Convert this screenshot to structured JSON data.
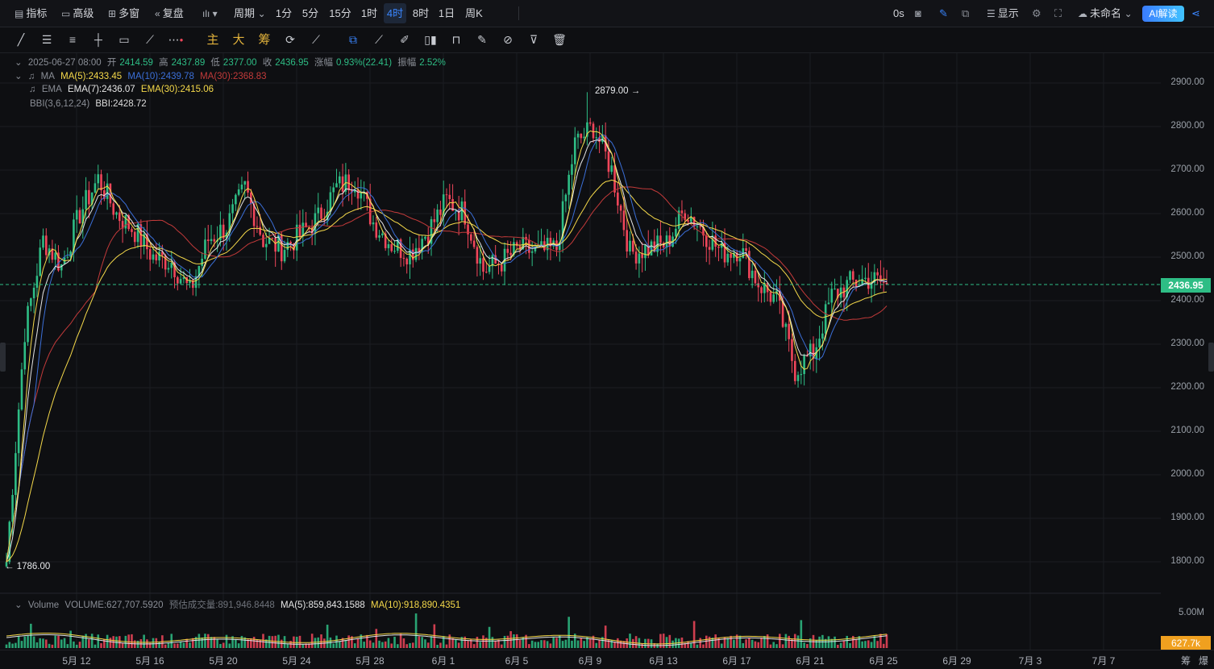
{
  "topbar": {
    "indicators": "指标",
    "advanced": "高级",
    "multiwindow": "多窗",
    "replay": "复盘",
    "period_menu": "周期",
    "periods": [
      "1分",
      "5分",
      "15分",
      "1时",
      "4时",
      "8时",
      "1日",
      "周K"
    ],
    "active_period": "4时",
    "countdown": "0s",
    "display": "显示",
    "layout_name": "未命名",
    "ai_button": "AI解读"
  },
  "toolbar2": {
    "main": "主",
    "big": "大",
    "chips": "筹"
  },
  "ohlc": {
    "datetime": "2025-06-27 08:00",
    "open_label": "开",
    "open": "2414.59",
    "high_label": "高",
    "high": "2437.89",
    "low_label": "低",
    "low": "2377.00",
    "close_label": "收",
    "close": "2436.95",
    "change_label": "涨幅",
    "change": "0.93%(22.41)",
    "amp_label": "振幅",
    "amp": "2.52%"
  },
  "indicators": {
    "ma_name": "MA",
    "ma5": "MA(5):2433.45",
    "ma10": "MA(10):2439.78",
    "ma30": "MA(30):2368.83",
    "ema_name": "EMA",
    "ema7": "EMA(7):2436.07",
    "ema30": "EMA(30):2415.06",
    "bbi_name": "BBI(3,6,12,24)",
    "bbi": "BBI:2428.72"
  },
  "volume_legend": {
    "name": "Volume",
    "volume": "VOLUME:627,707.5920",
    "est": "预估成交量:891,946.8448",
    "ma5": "MA(5):859,843.1588",
    "ma10": "MA(10):918,890.4351"
  },
  "price_axis": {
    "ticks": [
      "2900.00",
      "2800.00",
      "2700.00",
      "2600.00",
      "2500.00",
      "2400.00",
      "2300.00",
      "2200.00",
      "2100.00",
      "2000.00",
      "1900.00",
      "1800.00"
    ],
    "current": "2436.95",
    "vol_ticks": [
      "5.00M"
    ],
    "vol_current": "627.7k"
  },
  "annotations": {
    "high": "2879.00",
    "low": "1786.00"
  },
  "date_axis": {
    "labels": [
      "5月 12",
      "5月 16",
      "5月 20",
      "5月 24",
      "5月 28",
      "6月 1",
      "6月 5",
      "6月 9",
      "6月 13",
      "6月 17",
      "6月 21",
      "6月 25",
      "6月 29",
      "7月 3",
      "7月 7"
    ]
  },
  "bottom_right": [
    "筹",
    "爆"
  ],
  "colors": {
    "up": "#2ebd85",
    "down": "#f0465a",
    "ma5": "#f5d94a",
    "ma10": "#3b6fd8",
    "ma30": "#c23a3a",
    "ema7": "#e6e6e6",
    "ema30": "#f5d94a",
    "bbi": "#dddddd",
    "accent": "#3a86ff"
  },
  "chart_data": {
    "type": "candlestick",
    "interval": "4时",
    "ylim": [
      1760,
      2940
    ],
    "anchors": [
      [
        "5月 10",
        1800
      ],
      [
        "5月 11",
        2330
      ],
      [
        "5月 12",
        2540
      ],
      [
        "5月 13",
        2480
      ],
      [
        "5月 14",
        2600
      ],
      [
        "5月 15",
        2680
      ],
      [
        "5月 16",
        2600
      ],
      [
        "5月 17",
        2560
      ],
      [
        "5月 18",
        2500
      ],
      [
        "5月 19",
        2490
      ],
      [
        "5月 20",
        2420
      ],
      [
        "5月 21",
        2540
      ],
      [
        "5月 22",
        2570
      ],
      [
        "5月 23",
        2660
      ],
      [
        "5月 24",
        2540
      ],
      [
        "5月 25",
        2520
      ],
      [
        "5月 26",
        2550
      ],
      [
        "5月 27",
        2590
      ],
      [
        "5月 28",
        2660
      ],
      [
        "5月 29",
        2680
      ],
      [
        "5月 30",
        2580
      ],
      [
        "5月 31",
        2530
      ],
      [
        "6月 1",
        2510
      ],
      [
        "6月 2",
        2560
      ],
      [
        "6月 3",
        2630
      ],
      [
        "6月 4",
        2600
      ],
      [
        "6月 5",
        2470
      ],
      [
        "6月 6",
        2490
      ],
      [
        "6月 7",
        2520
      ],
      [
        "6月 8",
        2510
      ],
      [
        "6月 9",
        2520
      ],
      [
        "6月 10",
        2760
      ],
      [
        "6月 11",
        2800
      ],
      [
        "6月 12",
        2700
      ],
      [
        "6月 13",
        2510
      ],
      [
        "6月 14",
        2520
      ],
      [
        "6月 15",
        2530
      ],
      [
        "6月 16",
        2610
      ],
      [
        "6月 17",
        2560
      ],
      [
        "6月 18",
        2510
      ],
      [
        "6月 19",
        2520
      ],
      [
        "6月 20",
        2440
      ],
      [
        "6月 21",
        2400
      ],
      [
        "6月 22",
        2240
      ],
      [
        "6月 23",
        2280
      ],
      [
        "6月 24",
        2410
      ],
      [
        "6月 25",
        2440
      ],
      [
        "6月 26",
        2450
      ],
      [
        "6月 27",
        2437
      ]
    ],
    "high": 2879.0,
    "low": 1786.0,
    "last": 2436.95
  }
}
